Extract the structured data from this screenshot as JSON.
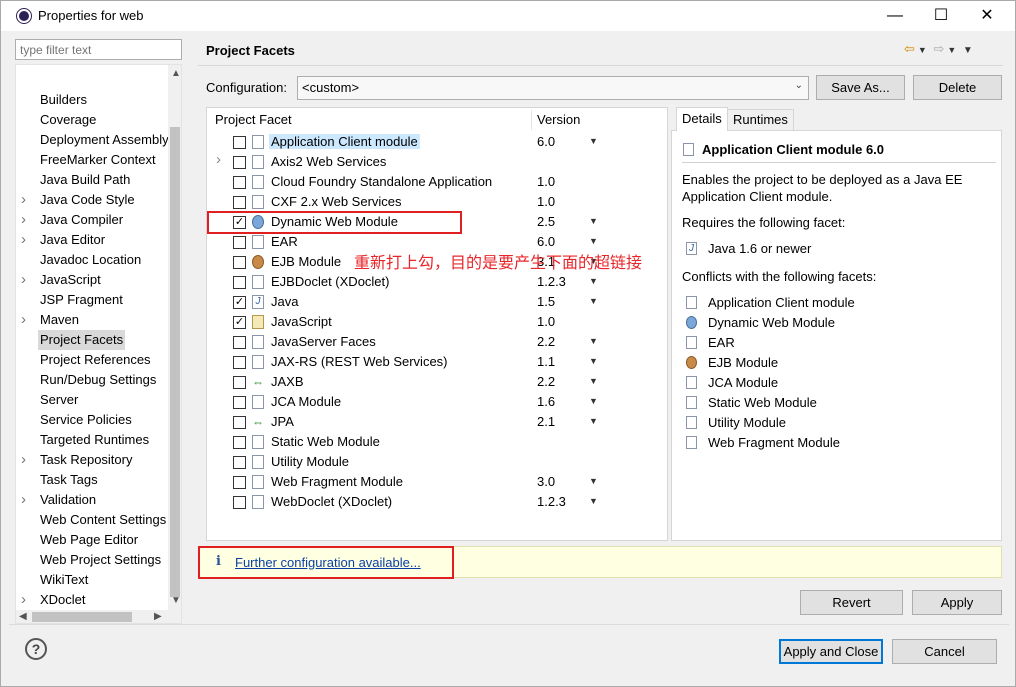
{
  "window": {
    "title": "Properties for web",
    "minimize": "—",
    "maximize": "☐",
    "close": "✕"
  },
  "filter": {
    "placeholder": "type filter text"
  },
  "tree": [
    {
      "label": "Builders",
      "expandable": false
    },
    {
      "label": "Coverage",
      "expandable": false
    },
    {
      "label": "Deployment Assembly",
      "expandable": false
    },
    {
      "label": "FreeMarker Context",
      "expandable": false
    },
    {
      "label": "Java Build Path",
      "expandable": false
    },
    {
      "label": "Java Code Style",
      "expandable": true
    },
    {
      "label": "Java Compiler",
      "expandable": true
    },
    {
      "label": "Java Editor",
      "expandable": true
    },
    {
      "label": "Javadoc Location",
      "expandable": false
    },
    {
      "label": "JavaScript",
      "expandable": true
    },
    {
      "label": "JSP Fragment",
      "expandable": false
    },
    {
      "label": "Maven",
      "expandable": true
    },
    {
      "label": "Project Facets",
      "expandable": false,
      "selected": true
    },
    {
      "label": "Project References",
      "expandable": false
    },
    {
      "label": "Run/Debug Settings",
      "expandable": false
    },
    {
      "label": "Server",
      "expandable": false
    },
    {
      "label": "Service Policies",
      "expandable": false
    },
    {
      "label": "Targeted Runtimes",
      "expandable": false
    },
    {
      "label": "Task Repository",
      "expandable": true
    },
    {
      "label": "Task Tags",
      "expandable": false
    },
    {
      "label": "Validation",
      "expandable": true
    },
    {
      "label": "Web Content Settings",
      "expandable": false
    },
    {
      "label": "Web Page Editor",
      "expandable": false
    },
    {
      "label": "Web Project Settings",
      "expandable": false
    },
    {
      "label": "WikiText",
      "expandable": false
    },
    {
      "label": "XDoclet",
      "expandable": true
    }
  ],
  "page": {
    "title": "Project Facets"
  },
  "configuration": {
    "label": "Configuration:",
    "value": "<custom>",
    "save_as": "Save As...",
    "delete": "Delete"
  },
  "facets_table": {
    "col_facet": "Project Facet",
    "col_version": "Version",
    "rows": [
      {
        "name": "Application Client module",
        "version": "6.0",
        "checked": false,
        "icon": "doc",
        "dropdown": true,
        "highlight": true,
        "expandable": false
      },
      {
        "name": "Axis2 Web Services",
        "version": "",
        "checked": false,
        "icon": "doc",
        "dropdown": false,
        "expandable": true
      },
      {
        "name": "Cloud Foundry Standalone Application",
        "version": "1.0",
        "checked": false,
        "icon": "none",
        "dropdown": false,
        "expandable": false
      },
      {
        "name": "CXF 2.x Web Services",
        "version": "1.0",
        "checked": false,
        "icon": "none",
        "dropdown": false,
        "expandable": false
      },
      {
        "name": "Dynamic Web Module",
        "version": "2.5",
        "checked": true,
        "icon": "globe",
        "dropdown": true,
        "expandable": false
      },
      {
        "name": "EAR",
        "version": "6.0",
        "checked": false,
        "icon": "none",
        "dropdown": true,
        "expandable": false
      },
      {
        "name": "EJB Module",
        "version": "3.1",
        "checked": false,
        "icon": "bean",
        "dropdown": true,
        "expandable": false
      },
      {
        "name": "EJBDoclet (XDoclet)",
        "version": "1.2.3",
        "checked": false,
        "icon": "none",
        "dropdown": true,
        "expandable": false
      },
      {
        "name": "Java",
        "version": "1.5",
        "checked": true,
        "icon": "java",
        "dropdown": true,
        "expandable": false
      },
      {
        "name": "JavaScript",
        "version": "1.0",
        "checked": true,
        "icon": "js",
        "dropdown": false,
        "expandable": false
      },
      {
        "name": "JavaServer Faces",
        "version": "2.2",
        "checked": false,
        "icon": "none",
        "dropdown": true,
        "expandable": false
      },
      {
        "name": "JAX-RS (REST Web Services)",
        "version": "1.1",
        "checked": false,
        "icon": "none",
        "dropdown": true,
        "expandable": false
      },
      {
        "name": "JAXB",
        "version": "2.2",
        "checked": false,
        "icon": "jaxb",
        "dropdown": true,
        "expandable": false
      },
      {
        "name": "JCA Module",
        "version": "1.6",
        "checked": false,
        "icon": "none",
        "dropdown": true,
        "expandable": false
      },
      {
        "name": "JPA",
        "version": "2.1",
        "checked": false,
        "icon": "jaxb",
        "dropdown": true,
        "expandable": false
      },
      {
        "name": "Static Web Module",
        "version": "",
        "checked": false,
        "icon": "none",
        "dropdown": false,
        "expandable": false
      },
      {
        "name": "Utility Module",
        "version": "",
        "checked": false,
        "icon": "none",
        "dropdown": false,
        "expandable": false
      },
      {
        "name": "Web Fragment Module",
        "version": "3.0",
        "checked": false,
        "icon": "none",
        "dropdown": true,
        "expandable": false
      },
      {
        "name": "WebDoclet (XDoclet)",
        "version": "1.2.3",
        "checked": false,
        "icon": "none",
        "dropdown": true,
        "expandable": false
      }
    ]
  },
  "annotation": "重新打上勾，目的是要产生下面的超链接",
  "details": {
    "tab_details": "Details",
    "tab_runtimes": "Runtimes",
    "title": "Application Client module 6.0",
    "description": "Enables the project to be deployed as a Java EE Application Client module.",
    "requires_label": "Requires the following facet:",
    "requires": [
      "Java 1.6 or newer"
    ],
    "conflicts_label": "Conflicts with the following facets:",
    "conflicts": [
      {
        "name": "Application Client module",
        "icon": "doc"
      },
      {
        "name": "Dynamic Web Module",
        "icon": "globe"
      },
      {
        "name": "EAR",
        "icon": "doc"
      },
      {
        "name": "EJB Module",
        "icon": "bean"
      },
      {
        "name": "JCA Module",
        "icon": "doc"
      },
      {
        "name": "Static Web Module",
        "icon": "doc"
      },
      {
        "name": "Utility Module",
        "icon": "doc"
      },
      {
        "name": "Web Fragment Module",
        "icon": "doc"
      }
    ]
  },
  "info": {
    "icon": "info-icon",
    "link": "Further configuration available..."
  },
  "buttons": {
    "revert": "Revert",
    "apply": "Apply",
    "apply_close": "Apply and Close",
    "cancel": "Cancel",
    "help": "?"
  },
  "colors": {
    "accent": "#0078d7",
    "annotation": "#e8262a",
    "info_bg": "#ffffe1",
    "link": "#0a3fa8"
  }
}
